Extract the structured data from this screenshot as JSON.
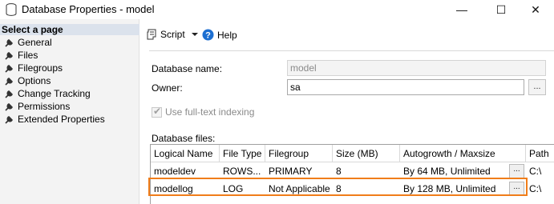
{
  "window": {
    "title": "Database Properties - model",
    "icon": "database-icon",
    "minimize_glyph": "—",
    "maximize_glyph": "☐",
    "close_glyph": "✕"
  },
  "sidebar": {
    "header": "Select a page",
    "items": [
      {
        "label": "General"
      },
      {
        "label": "Files"
      },
      {
        "label": "Filegroups"
      },
      {
        "label": "Options"
      },
      {
        "label": "Change Tracking"
      },
      {
        "label": "Permissions"
      },
      {
        "label": "Extended Properties"
      }
    ]
  },
  "toolbar": {
    "script_label": "Script",
    "help_label": "Help"
  },
  "form": {
    "database_name_label": "Database name:",
    "database_name_value": "model",
    "owner_label": "Owner:",
    "owner_value": "sa",
    "owner_browse": "...",
    "fulltext_label": "Use full-text indexing",
    "database_files_label": "Database files:"
  },
  "grid": {
    "columns": [
      "Logical Name",
      "File Type",
      "Filegroup",
      "Size (MB)",
      "Autogrowth / Maxsize",
      "Path"
    ],
    "rows": [
      {
        "logical_name": "modeldev",
        "file_type": "ROWS...",
        "filegroup": "PRIMARY",
        "size": "8",
        "autogrowth": "By 64 MB, Unlimited",
        "btn": "...",
        "path": "C:\\"
      },
      {
        "logical_name": "modellog",
        "file_type": "LOG",
        "filegroup": "Not Applicable",
        "size": "8",
        "autogrowth": "By 128 MB, Unlimited",
        "btn": "...",
        "path": "C:\\"
      }
    ]
  },
  "colors": {
    "highlight": "#f07d1a",
    "help_icon": "#1d6fd1"
  }
}
